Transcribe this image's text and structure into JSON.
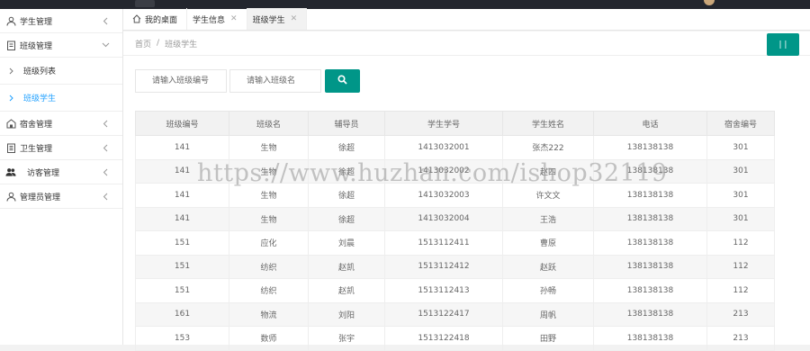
{
  "sidebar": {
    "items": [
      {
        "label": "学生管理",
        "icon": "user-icon",
        "expanded": false
      },
      {
        "label": "班级管理",
        "icon": "clipboard-icon",
        "expanded": true,
        "children": [
          {
            "label": "班级列表",
            "active": false
          },
          {
            "label": "班级学生",
            "active": true
          }
        ]
      },
      {
        "label": "宿舍管理",
        "icon": "building-icon",
        "expanded": false
      },
      {
        "label": "卫生管理",
        "icon": "list-icon",
        "expanded": false
      },
      {
        "label": "访客管理",
        "icon": "users-icon",
        "expanded": false
      },
      {
        "label": "管理员管理",
        "icon": "admin-icon",
        "expanded": false
      }
    ]
  },
  "tabs": [
    {
      "label": "我的桌面",
      "closable": false,
      "active": false
    },
    {
      "label": "学生信息",
      "closable": true,
      "active": false
    },
    {
      "label": "班级学生",
      "closable": true,
      "active": true
    }
  ],
  "breadcrumb": {
    "home": "首页",
    "sep": "/",
    "current": "班级学生"
  },
  "search": {
    "class_no_placeholder": "请输入班级编号",
    "class_name_placeholder": "请输入班级名"
  },
  "table": {
    "headers": [
      "班级编号",
      "班级名",
      "辅导员",
      "学生学号",
      "学生姓名",
      "电话",
      "宿舍编号"
    ],
    "rows": [
      [
        "141",
        "生物",
        "徐超",
        "1413032001",
        "张杰222",
        "138138138",
        "301"
      ],
      [
        "141",
        "生物",
        "徐超",
        "1413032002",
        "赵四",
        "138138138",
        "301"
      ],
      [
        "141",
        "生物",
        "徐超",
        "1413032003",
        "许文文",
        "138138138",
        "301"
      ],
      [
        "141",
        "生物",
        "徐超",
        "1413032004",
        "王浩",
        "138138138",
        "301"
      ],
      [
        "151",
        "应化",
        "刘晨",
        "1513112411",
        "曹原",
        "138138138",
        "112"
      ],
      [
        "151",
        "纺织",
        "赵凯",
        "1513112412",
        "赵跃",
        "138138138",
        "112"
      ],
      [
        "151",
        "纺织",
        "赵凯",
        "1513112413",
        "孙畅",
        "138138138",
        "112"
      ],
      [
        "161",
        "物流",
        "刘阳",
        "1513122417",
        "周帆",
        "138138138",
        "213"
      ],
      [
        "153",
        "数师",
        "张宇",
        "1513122418",
        "田野",
        "138138138",
        "213"
      ]
    ]
  },
  "watermark": "https://www.huzhan.com/ishop32119",
  "colors": {
    "accent": "#009688",
    "active_link": "#1e9fff",
    "topbar": "#23262e"
  }
}
